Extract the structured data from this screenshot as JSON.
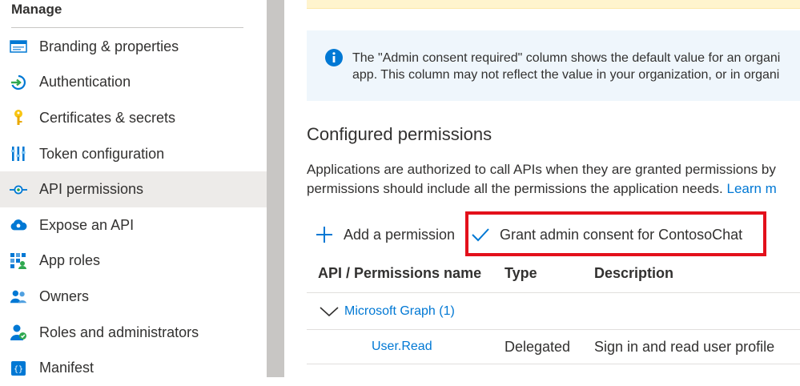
{
  "sidebar": {
    "heading": "Manage",
    "items": [
      {
        "label": "Branding & properties",
        "icon": "branding-icon",
        "selected": false
      },
      {
        "label": "Authentication",
        "icon": "authentication-icon",
        "selected": false
      },
      {
        "label": "Certificates & secrets",
        "icon": "key-icon",
        "selected": false
      },
      {
        "label": "Token configuration",
        "icon": "token-icon",
        "selected": false
      },
      {
        "label": "API permissions",
        "icon": "api-permissions-icon",
        "selected": true
      },
      {
        "label": "Expose an API",
        "icon": "cloud-icon",
        "selected": false
      },
      {
        "label": "App roles",
        "icon": "app-roles-icon",
        "selected": false
      },
      {
        "label": "Owners",
        "icon": "owners-icon",
        "selected": false
      },
      {
        "label": "Roles and administrators",
        "icon": "roles-admin-icon",
        "selected": false
      },
      {
        "label": "Manifest",
        "icon": "manifest-icon",
        "selected": false
      }
    ]
  },
  "info": {
    "line1": "The \"Admin consent required\" column shows the default value for an organi",
    "line2": "app. This column may not reflect the value in your organization, or in organi"
  },
  "section": {
    "title": "Configured permissions",
    "desc_line1": "Applications are authorized to call APIs when they are granted permissions by",
    "desc_line2": "permissions should include all the permissions the application needs.",
    "learn_more": "Learn m"
  },
  "commands": {
    "add_permission": "Add a permission",
    "grant_consent": "Grant admin consent for ContosoChat"
  },
  "table": {
    "columns": [
      "API / Permissions name",
      "Type",
      "Description"
    ],
    "group": {
      "label": "Microsoft Graph (1)",
      "expanded": true
    },
    "rows": [
      {
        "name": "User.Read",
        "type": "Delegated",
        "description": "Sign in and read user profile"
      }
    ]
  },
  "colors": {
    "accent": "#0078d4",
    "highlight": "#e3101b",
    "info_bg": "#eff6fc",
    "selected_bg": "#edebe9"
  }
}
